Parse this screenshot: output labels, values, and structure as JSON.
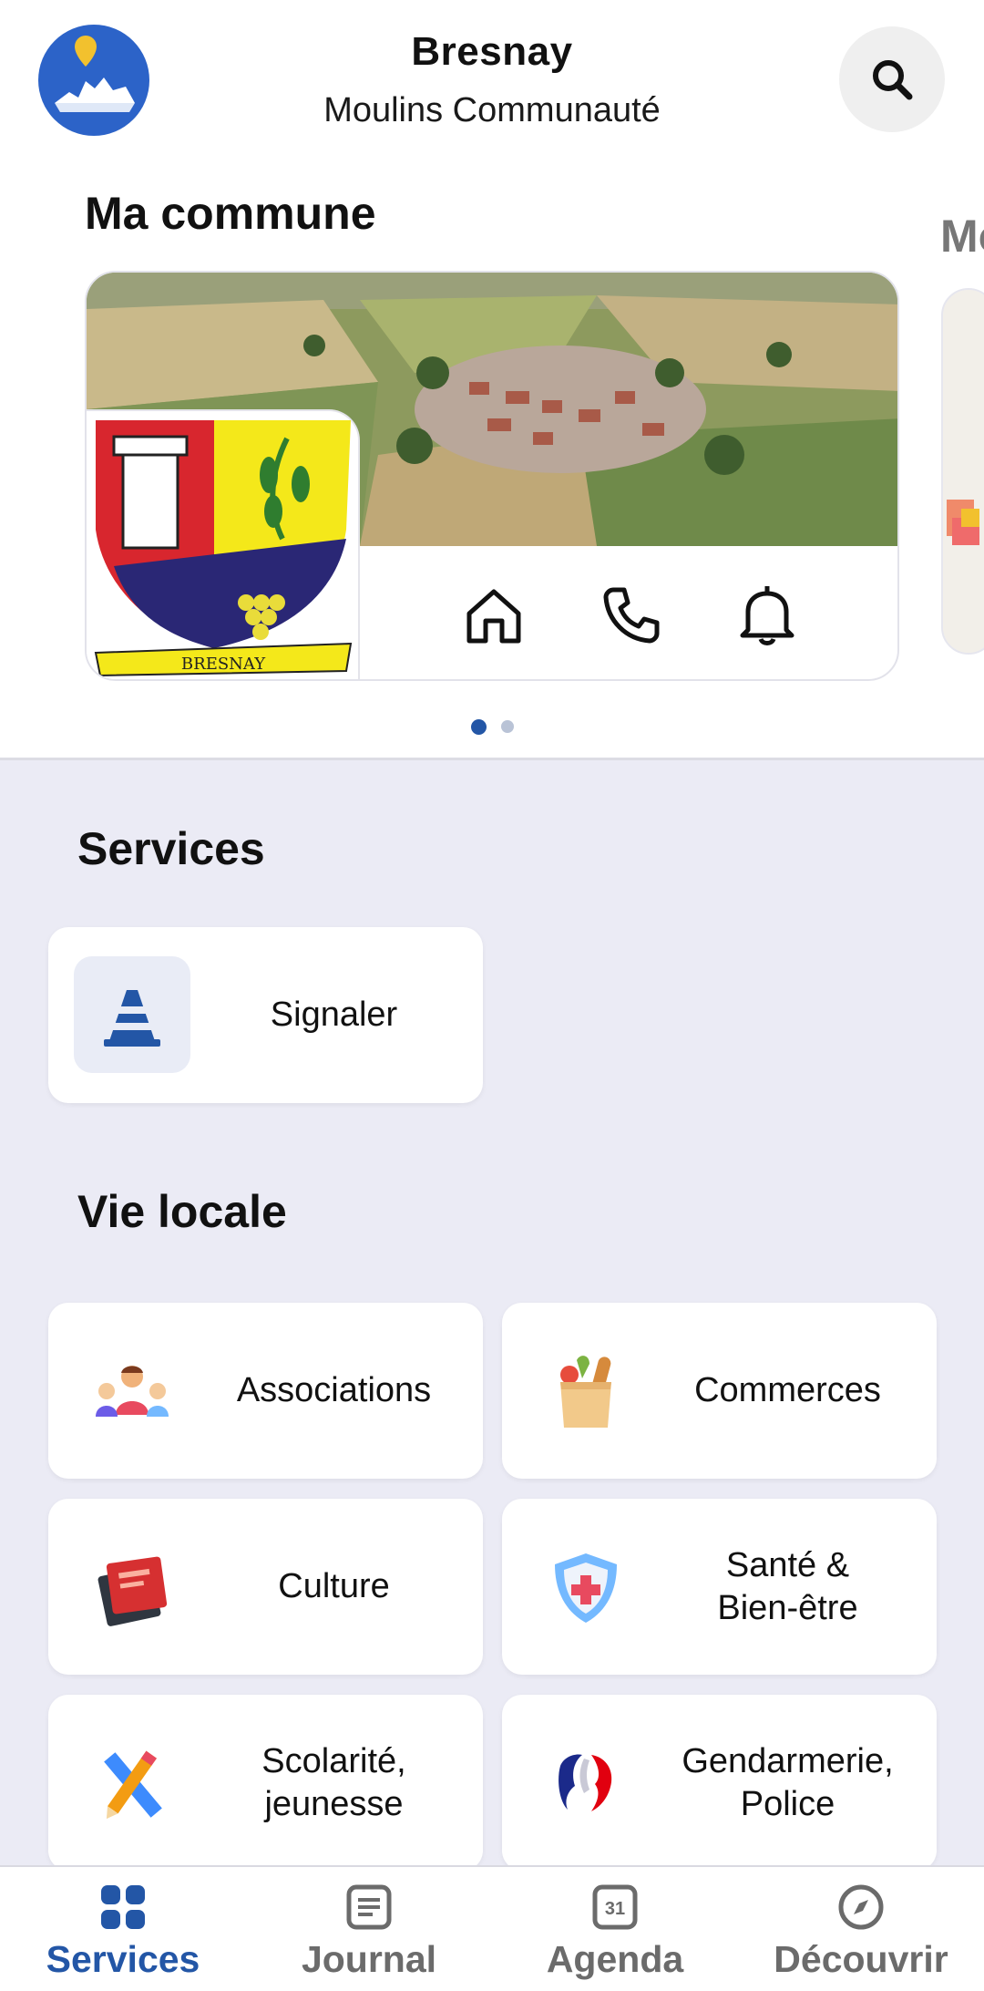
{
  "header": {
    "title": "Bresnay",
    "subtitle": "Moulins Communauté"
  },
  "commune": {
    "section_title": "Ma commune",
    "next_section_peek": "Mo",
    "crest_text": "BRESNAY",
    "carousel_page": 1,
    "carousel_pages": 2
  },
  "services": {
    "title": "Services",
    "items": [
      {
        "label": "Signaler",
        "icon": "traffic-cone-icon"
      }
    ]
  },
  "vie_locale": {
    "title": "Vie locale",
    "items": [
      {
        "label": "Associations",
        "icon": "people-group-icon"
      },
      {
        "label": "Commerces",
        "icon": "grocery-bag-icon"
      },
      {
        "label": "Culture",
        "icon": "books-icon"
      },
      {
        "label": "Santé &\nBien-être",
        "icon": "health-shield-icon"
      },
      {
        "label": "Scolarité,\njeunesse",
        "icon": "pencil-ruler-icon"
      },
      {
        "label": "Gendarmerie,\nPolice",
        "icon": "marianne-icon"
      }
    ]
  },
  "nav": {
    "items": [
      {
        "label": "Services",
        "icon": "grid-icon",
        "active": true
      },
      {
        "label": "Journal",
        "icon": "newspaper-icon",
        "active": false
      },
      {
        "label": "Agenda",
        "icon": "calendar-icon",
        "active": false,
        "icon_text": "31"
      },
      {
        "label": "Découvrir",
        "icon": "compass-icon",
        "active": false
      }
    ]
  },
  "colors": {
    "accent": "#2356a6",
    "background": "#ebebf5",
    "logo": "#2c63c8"
  }
}
